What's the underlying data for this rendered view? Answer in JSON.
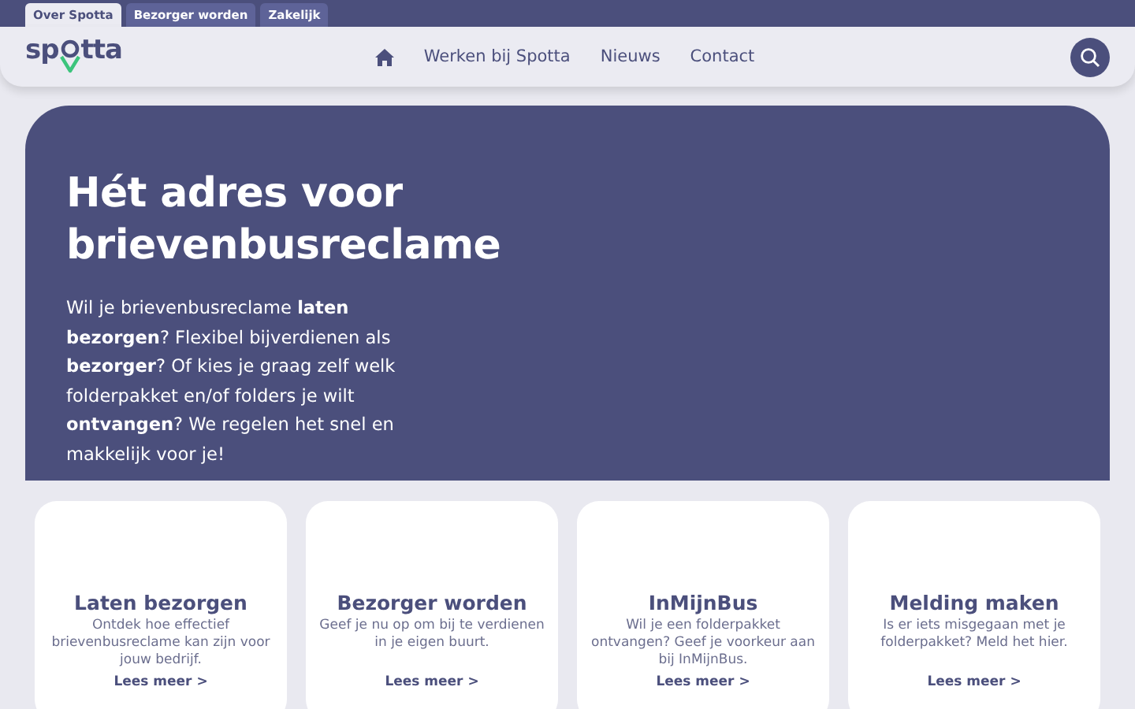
{
  "top_tabs": [
    {
      "label": "Over Spotta",
      "selected": true
    },
    {
      "label": "Bezorger worden",
      "selected": false
    },
    {
      "label": "Zakelijk",
      "selected": false
    }
  ],
  "logo": {
    "before": "sp",
    "after": "tta"
  },
  "nav": [
    "Werken bij Spotta",
    "Nieuws",
    "Contact"
  ],
  "hero": {
    "title": "Hét adres voor brievenbusreclame",
    "text": "Wil je brievenbusreclame **laten bezorgen**? Flexibel bijverdienen als **bezorger**? Of kies je graag zelf welk folderpakket en/of folders je wilt **ontvangen**? We regelen het snel en makkelijk voor je!"
  },
  "cards": [
    {
      "title": "Laten bezorgen",
      "text": "Ontdek hoe effectief brievenbusreclame kan zijn voor jouw bedrijf.",
      "link": "Lees meer >"
    },
    {
      "title": "Bezorger worden",
      "text": "Geef je nu op om bij te verdienen in je eigen buurt.",
      "link": "Lees meer >"
    },
    {
      "title": "InMijnBus",
      "text": "Wil je een folderpakket ontvangen? Geef je voorkeur aan bij InMijnBus.",
      "link": "Lees meer >"
    },
    {
      "title": "Melding maken",
      "text": "Is er iets misgegaan met je folderpakket? Meld het hier.",
      "link": "Lees meer >"
    }
  ]
}
